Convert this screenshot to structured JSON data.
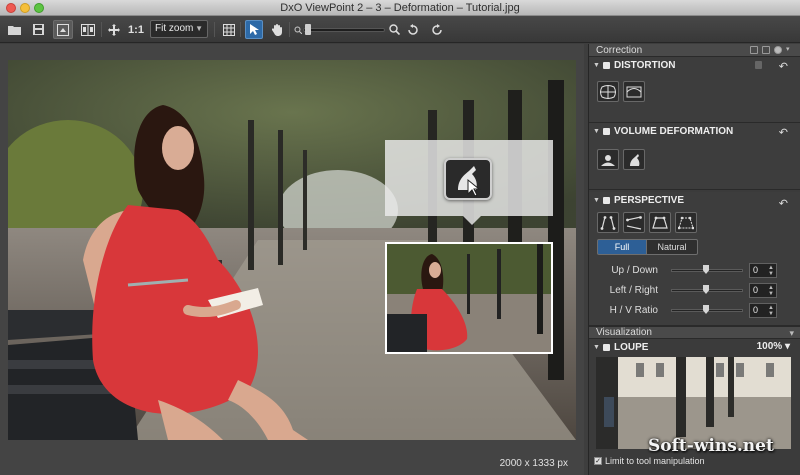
{
  "window": {
    "title": "DxO ViewPoint 2 – 3 – Deformation – Tutorial.jpg"
  },
  "toolbar": {
    "actual_size_label": "1:1",
    "zoom_select": "Fit zoom"
  },
  "canvas": {
    "image_dimensions": "2000 x 1333 px"
  },
  "panel": {
    "correction_header": "Correction",
    "sections": {
      "distortion": "DISTORTION",
      "volume": "VOLUME DEFORMATION",
      "perspective": "PERSPECTIVE"
    },
    "perspective_modes": {
      "full": "Full",
      "natural": "Natural"
    },
    "sliders": [
      {
        "label": "Up / Down",
        "value": "0"
      },
      {
        "label": "Left / Right",
        "value": "0"
      },
      {
        "label": "H / V Ratio",
        "value": "0"
      }
    ],
    "visualization_header": "Visualization",
    "loupe": {
      "title": "LOUPE",
      "zoom": "100%"
    },
    "limit_label": "Limit to tool manipulation"
  },
  "watermark": "Soft-wins.net",
  "colors": {
    "accent": "#2d6aa8",
    "dress": "#d8373a",
    "panel_bg": "#3b3b3b"
  },
  "icons": [
    "folder-icon",
    "save-icon",
    "display-mode-icon",
    "compare-icon",
    "move-icon",
    "grid-icon",
    "pointer-icon",
    "hand-icon",
    "zoom-out-icon",
    "zoom-in-icon",
    "rotate-left-icon",
    "rotate-right-icon"
  ]
}
